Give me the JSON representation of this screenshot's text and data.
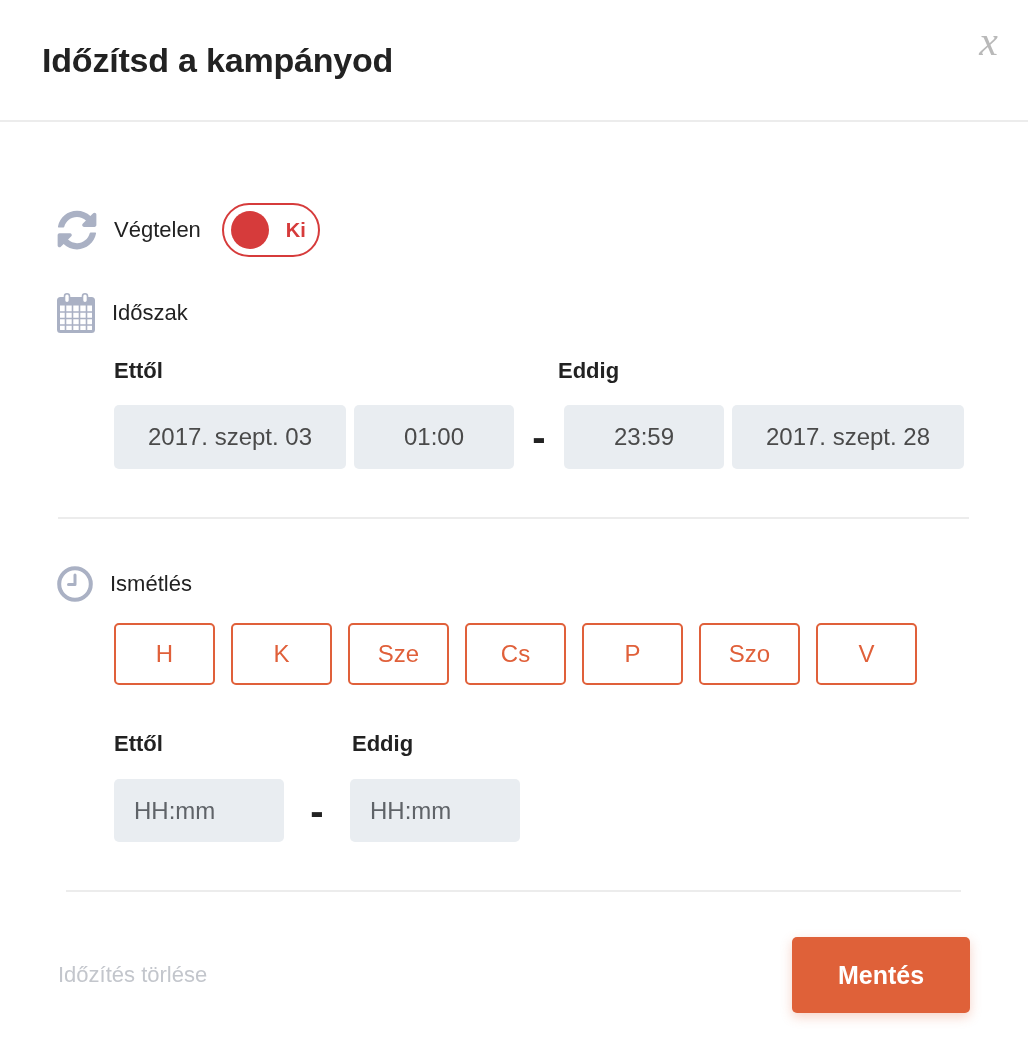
{
  "header": {
    "title": "Időzítsd a kampányod",
    "close": "x"
  },
  "infinite": {
    "label": "Végtelen",
    "toggle": {
      "on": false,
      "text": "Ki"
    }
  },
  "period": {
    "label": "Időszak",
    "from": {
      "label": "Ettől",
      "date": "2017. szept. 03",
      "time": "01:00"
    },
    "separator": "-",
    "to": {
      "label": "Eddig",
      "time": "23:59",
      "date": "2017. szept. 28"
    }
  },
  "repeat": {
    "label": "Ismétlés",
    "days": [
      {
        "label": "H",
        "selected": false
      },
      {
        "label": "K",
        "selected": false
      },
      {
        "label": "Sze",
        "selected": false
      },
      {
        "label": "Cs",
        "selected": false
      },
      {
        "label": "P",
        "selected": false
      },
      {
        "label": "Szo",
        "selected": false
      },
      {
        "label": "V",
        "selected": false
      }
    ],
    "from": {
      "label": "Ettől",
      "placeholder": "HH:mm"
    },
    "separator": "-",
    "to": {
      "label": "Eddig",
      "placeholder": "HH:mm"
    }
  },
  "footer": {
    "clear_link": "Időzítés törlése",
    "save_button": "Mentés"
  }
}
